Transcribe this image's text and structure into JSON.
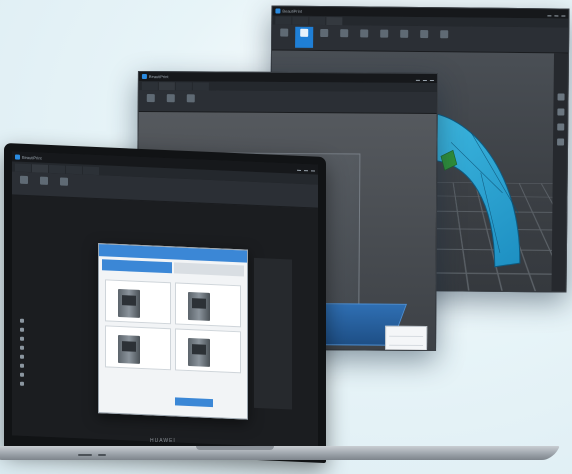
{
  "app": {
    "name": "BeautiPrint"
  },
  "back_window": {
    "title": "",
    "tabs": [
      "",
      "",
      "",
      ""
    ],
    "ribbon": [
      "",
      "",
      "",
      "",
      "",
      "",
      "",
      "",
      ""
    ]
  },
  "middle_window": {
    "title": "",
    "tabs": [
      "",
      "",
      "",
      ""
    ],
    "ribbon": [
      "",
      "",
      ""
    ]
  },
  "laptop": {
    "brand": "HUAWEI",
    "tabs": [
      "",
      "",
      "",
      "",
      ""
    ],
    "ribbon": [
      "",
      "",
      ""
    ],
    "side_list": [
      "",
      "",
      "",
      "",
      "",
      "",
      "",
      ""
    ],
    "side_notes": [
      "",
      "",
      ""
    ],
    "dialog": {
      "header": "",
      "tabs": [
        "",
        ""
      ],
      "subtitle": "",
      "printers": [
        "",
        "",
        "",
        ""
      ],
      "confirm": "",
      "cancel": ""
    },
    "settings": [
      "",
      "",
      "",
      "",
      "",
      "",
      "",
      "",
      "",
      "",
      "",
      ""
    ]
  },
  "colors": {
    "accent": "#1f7fd6",
    "model": "#2fb7e0",
    "background": "#eaf5f9"
  }
}
